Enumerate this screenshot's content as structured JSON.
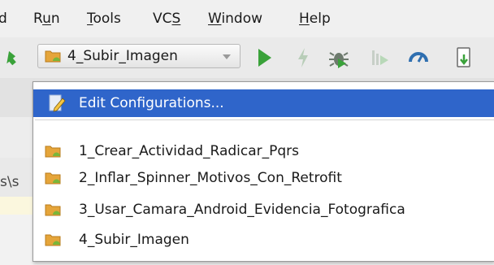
{
  "menubar": {
    "items": [
      {
        "before": "",
        "mnemonic": "",
        "after": "d"
      },
      {
        "before": "R",
        "mnemonic": "u",
        "after": "n"
      },
      {
        "before": "",
        "mnemonic": "T",
        "after": "ools"
      },
      {
        "before": "VC",
        "mnemonic": "S",
        "after": ""
      },
      {
        "before": "",
        "mnemonic": "W",
        "after": "indow"
      },
      {
        "before": "",
        "mnemonic": "H",
        "after": "elp"
      }
    ]
  },
  "toolbar": {
    "run_config_selected": "4_Subir_Imagen",
    "icons": [
      "back-arrow-icon",
      "folder-android-icon",
      "run-icon",
      "apply-changes-icon",
      "debug-icon",
      "attach-debugger-icon",
      "profile-icon",
      "sdk-manager-icon"
    ]
  },
  "background": {
    "path_fragment": "s\\s"
  },
  "dropdown": {
    "edit_label": "Edit Configurations...",
    "items": [
      "1_Crear_Actividad_Radicar_Pqrs",
      "2_Inflar_Spinner_Motivos_Con_Retrofit",
      "3_Usar_Camara_Android_Evidencia_Fotografica",
      "4_Subir_Imagen"
    ]
  },
  "colors": {
    "selection": "#2f65ca",
    "run_green": "#3aa23a",
    "folder_orange": "#e5a53a",
    "android_green": "#79b63a"
  }
}
